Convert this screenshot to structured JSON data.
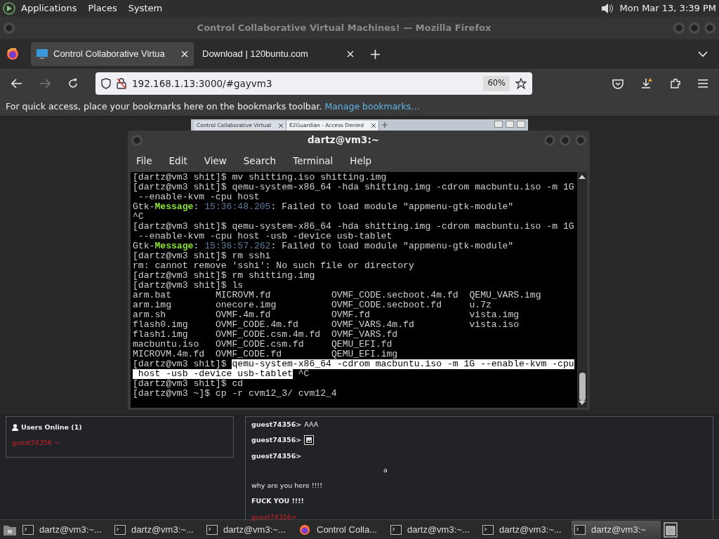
{
  "top_panel": {
    "menus": [
      "Applications",
      "Places",
      "System"
    ],
    "clock": "Mon Mar 13,  3:39 PM"
  },
  "window": {
    "title": "Control Collaborative Virtual Machines! — Mozilla Firefox"
  },
  "tabs": [
    {
      "label": "Control Collaborative Virtua",
      "selected": true
    },
    {
      "label": "Download | 120buntu.com",
      "selected": false
    }
  ],
  "toolbar": {
    "forward_disabled": true,
    "url": "192.168.1.13:3000/#gayvm3",
    "zoom": "60%"
  },
  "bookmarks_bar": {
    "text": "For quick access, place your bookmarks here on the bookmarks toolbar.",
    "link": "Manage bookmarks…"
  },
  "vm_browser_tabs": [
    {
      "label": "Control Collaborative Virtual",
      "selected": false
    },
    {
      "label": "E2Guardian - Access Denied",
      "selected": true
    }
  ],
  "terminal": {
    "title": "dartz@vm3:~",
    "menus": [
      "File",
      "Edit",
      "View",
      "Search",
      "Terminal",
      "Help"
    ],
    "lines": [
      [
        {
          "kind": "text",
          "text": "[dartz@vm3 shit]$ mv shitting.iso shitting.img"
        }
      ],
      [
        {
          "kind": "text",
          "text": "[dartz@vm3 shit]$ qemu-system-x86_64 -hda shitting.img -cdrom macbuntu.iso -m 1G"
        }
      ],
      [
        {
          "kind": "text",
          "text": " --enable-kvm -cpu host"
        }
      ],
      [
        {
          "kind": "text",
          "text": "Gtk-"
        },
        {
          "kind": "message",
          "text": "Message"
        },
        {
          "kind": "text",
          "text": ": "
        },
        {
          "kind": "dim",
          "text": "15:36:48.205"
        },
        {
          "kind": "text",
          "text": ": Failed to load module \"appmenu-gtk-module\""
        }
      ],
      [
        {
          "kind": "text",
          "text": "^C"
        }
      ],
      [
        {
          "kind": "text",
          "text": "[dartz@vm3 shit]$ qemu-system-x86_64 -hda shitting.img -cdrom macbuntu.iso -m 1G"
        }
      ],
      [
        {
          "kind": "text",
          "text": " --enable-kvm -cpu host -usb -device usb-tablet"
        }
      ],
      [
        {
          "kind": "text",
          "text": "Gtk-"
        },
        {
          "kind": "message",
          "text": "Message"
        },
        {
          "kind": "text",
          "text": ": "
        },
        {
          "kind": "dim",
          "text": "15:36:57.262"
        },
        {
          "kind": "text",
          "text": ": Failed to load module \"appmenu-gtk-module\""
        }
      ],
      [
        {
          "kind": "text",
          "text": "[dartz@vm3 shit]$ rm sshi"
        }
      ],
      [
        {
          "kind": "text",
          "text": "rm: cannot remove 'sshi': No such file or directory"
        }
      ],
      [
        {
          "kind": "text",
          "text": "[dartz@vm3 shit]$ rm shitting.img"
        }
      ],
      [
        {
          "kind": "text",
          "text": "[dartz@vm3 shit]$ ls"
        }
      ],
      [
        {
          "kind": "listing",
          "cells": [
            "arm.bat",
            "MICROVM.fd",
            "OVMF_CODE.secboot.4m.fd",
            "QEMU_VARS.img"
          ]
        }
      ],
      [
        {
          "kind": "listing",
          "cells": [
            "arm.img",
            "onecore.img",
            "OVMF_CODE.secboot.fd",
            "u.7z"
          ]
        }
      ],
      [
        {
          "kind": "listing",
          "cells": [
            "arm.sh",
            "OVMF.4m.fd",
            "OVMF.fd",
            "vista.img"
          ]
        }
      ],
      [
        {
          "kind": "listing",
          "cells": [
            "flash0.img",
            "OVMF_CODE.4m.fd",
            "OVMF_VARS.4m.fd",
            "vista.iso"
          ]
        }
      ],
      [
        {
          "kind": "listing",
          "cells": [
            "flash1.img",
            "OVMF_CODE.csm.4m.fd",
            "OVMF_VARS.fd"
          ]
        }
      ],
      [
        {
          "kind": "listing",
          "cells": [
            "macbuntu.iso",
            "OVMF_CODE.csm.fd",
            "QEMU_EFI.fd"
          ]
        }
      ],
      [
        {
          "kind": "listing",
          "cells": [
            "MICROVM.4m.fd",
            "OVMF_CODE.fd",
            "QEMU_EFI.img"
          ]
        }
      ],
      [
        {
          "kind": "text",
          "text": "[dartz@vm3 shit]$ "
        },
        {
          "kind": "selected",
          "text": "qemu-system-x86_64 -cdrom macbuntu.iso -m 1G --enable-kvm -cpu"
        }
      ],
      [
        {
          "kind": "selected",
          "text": " host -usb -device usb-tablet"
        },
        {
          "kind": "text",
          "text": " ^C"
        }
      ],
      [
        {
          "kind": "text",
          "text": "[dartz@vm3 shit]$ cd"
        }
      ],
      [
        {
          "kind": "text",
          "text": "[dartz@vm3 ~]$ cp -r cvm12_3/ cvm12_4"
        }
      ]
    ]
  },
  "users_panel": {
    "title": "Users Online (1)",
    "users": [
      "guest74356 ~"
    ]
  },
  "chat": [
    {
      "kind": "message",
      "user": "guest74356>",
      "text": "AAA"
    },
    {
      "kind": "image",
      "user": "guest74356>"
    },
    {
      "kind": "centered",
      "user": "guest74356>",
      "text": "a"
    },
    {
      "kind": "plain",
      "text": "why are you here !!!!"
    },
    {
      "kind": "bold",
      "text": "FUCK YOU !!!!"
    },
    {
      "kind": "self",
      "user": "guest74356>"
    }
  ],
  "taskbar": [
    {
      "kind": "terminal",
      "label": "dartz@vm3:~...",
      "selected": false
    },
    {
      "kind": "terminal",
      "label": "dartz@vm3:~...",
      "selected": false
    },
    {
      "kind": "terminal",
      "label": "dartz@vm3:~...",
      "selected": false
    },
    {
      "kind": "browser",
      "label": "Control Colla...",
      "selected": false
    },
    {
      "kind": "terminal",
      "label": "dartz@vm3:~...",
      "selected": false
    },
    {
      "kind": "terminal",
      "label": "dartz@vm3:~...",
      "selected": false
    },
    {
      "kind": "terminal",
      "label": "dartz@vm3:~",
      "selected": true
    }
  ]
}
